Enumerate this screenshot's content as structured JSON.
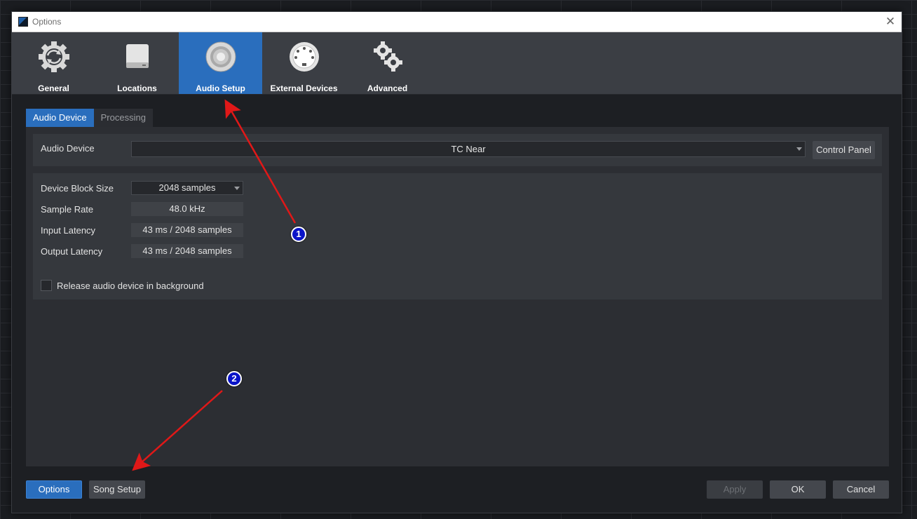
{
  "window": {
    "title": "Options",
    "close_glyph": "✕"
  },
  "toolbar": {
    "items": [
      {
        "label": "General",
        "icon": "gear-refresh-icon"
      },
      {
        "label": "Locations",
        "icon": "hard-drive-icon"
      },
      {
        "label": "Audio Setup",
        "icon": "speaker-icon",
        "active": true
      },
      {
        "label": "External Devices",
        "icon": "midi-port-icon"
      },
      {
        "label": "Advanced",
        "icon": "gears-icon"
      }
    ]
  },
  "tabs": [
    {
      "label": "Audio Device",
      "active": true
    },
    {
      "label": "Processing",
      "active": false
    }
  ],
  "device": {
    "label": "Audio Device",
    "value": "TC Near",
    "control_panel": "Control Panel"
  },
  "settings": {
    "block_size": {
      "label": "Device Block Size",
      "value": "2048 samples"
    },
    "sample_rate": {
      "label": "Sample Rate",
      "value": "48.0 kHz"
    },
    "input_latency": {
      "label": "Input Latency",
      "value": "43 ms / 2048 samples"
    },
    "output_latency": {
      "label": "Output Latency",
      "value": "43 ms / 2048 samples"
    },
    "release_bg": {
      "label": "Release audio device in background",
      "checked": false
    }
  },
  "footer": {
    "options": "Options",
    "song_setup": "Song Setup",
    "apply": "Apply",
    "ok": "OK",
    "cancel": "Cancel"
  },
  "annotations": {
    "badge1": "1",
    "badge2": "2"
  },
  "colors": {
    "accent": "#2a6ebd",
    "arrow": "#e01818",
    "badge": "#0a14c8"
  }
}
